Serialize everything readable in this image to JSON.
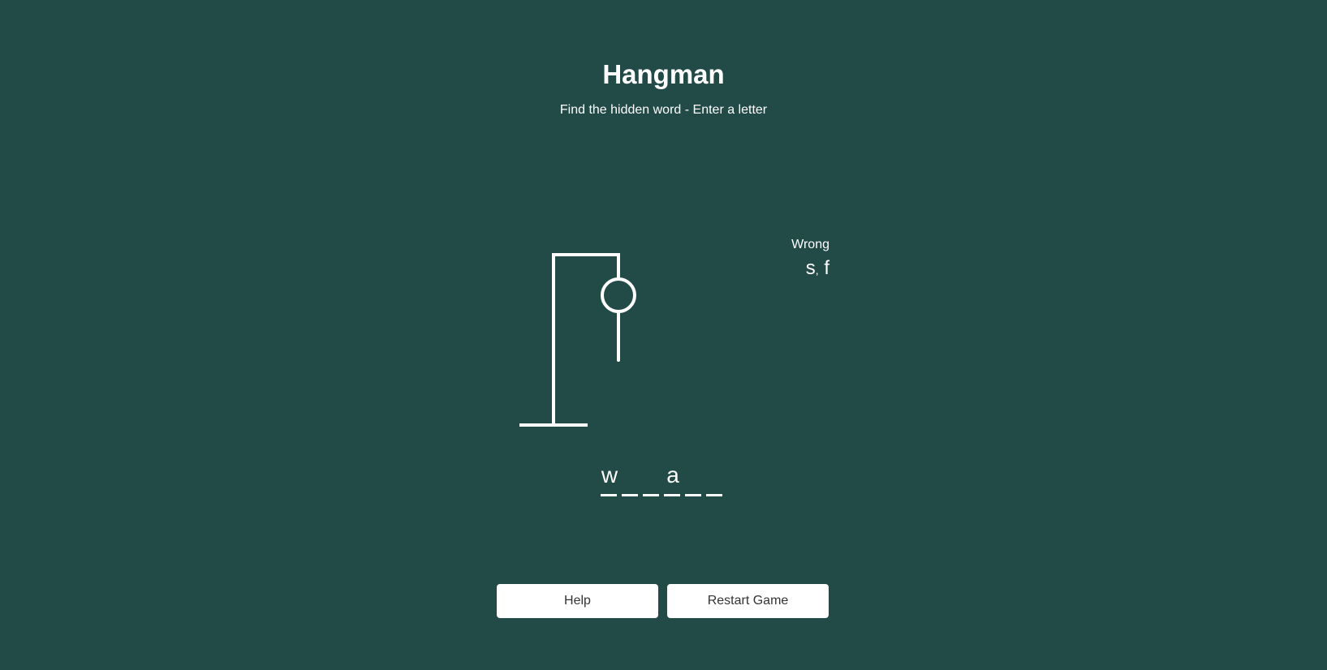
{
  "header": {
    "title": "Hangman",
    "subtitle": "Find the hidden word - Enter a letter"
  },
  "wrong": {
    "label": "Wrong",
    "letters": [
      "s",
      "f"
    ],
    "separator": ","
  },
  "word": {
    "slots": [
      "w",
      "",
      "",
      "a",
      "",
      ""
    ]
  },
  "figure": {
    "parts_shown": [
      "base",
      "pole",
      "beam",
      "rope",
      "head",
      "body"
    ]
  },
  "buttons": {
    "help_label": "Help",
    "restart_label": "Restart Game"
  },
  "colors": {
    "background": "#224a47",
    "foreground": "#ffffff",
    "button_text": "#333333"
  }
}
